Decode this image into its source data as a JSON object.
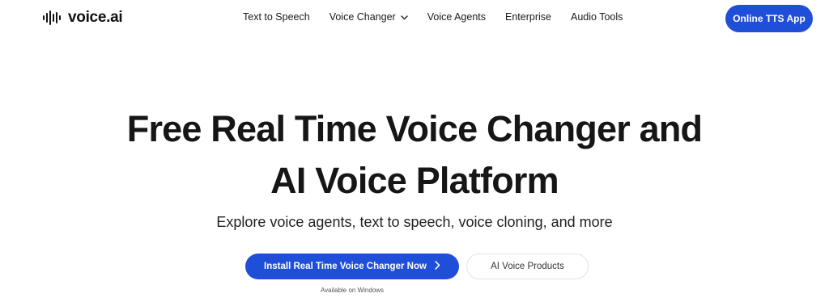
{
  "brand": {
    "name": "voice.ai",
    "accent_color": "#1f4fd8"
  },
  "nav": {
    "items": [
      {
        "label": "Text to Speech"
      },
      {
        "label": "Voice Changer",
        "has_dropdown": true
      },
      {
        "label": "Voice Agents"
      },
      {
        "label": "Enterprise"
      },
      {
        "label": "Audio Tools"
      }
    ],
    "cta_label": "Online TTS App"
  },
  "hero": {
    "title_line1": "Free Real Time Voice Changer and",
    "title_line2": "AI Voice Platform",
    "subtitle": "Explore voice agents, text to speech, voice cloning, and more",
    "primary_label": "Install Real Time Voice Changer Now",
    "secondary_label": "AI Voice Products",
    "note": "Available on Windows"
  },
  "icons": {
    "logo": "waveform-icon",
    "dropdown": "chevron-down-icon",
    "primary_arrow": "chevron-right-icon"
  }
}
